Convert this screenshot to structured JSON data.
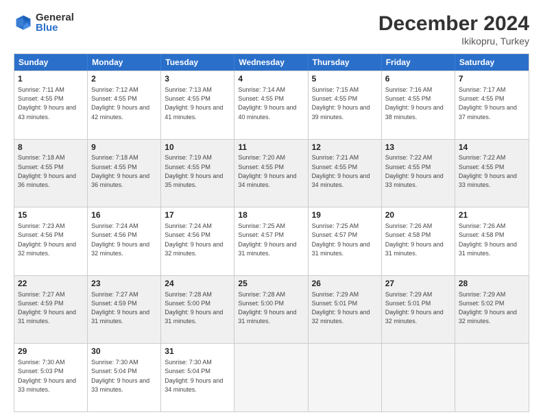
{
  "logo": {
    "general": "General",
    "blue": "Blue"
  },
  "title": "December 2024",
  "location": "Ikikopru, Turkey",
  "days": [
    "Sunday",
    "Monday",
    "Tuesday",
    "Wednesday",
    "Thursday",
    "Friday",
    "Saturday"
  ],
  "weeks": [
    [
      {
        "day": "1",
        "rise": "7:11 AM",
        "set": "4:55 PM",
        "daylight": "9 hours and 43 minutes."
      },
      {
        "day": "2",
        "rise": "7:12 AM",
        "set": "4:55 PM",
        "daylight": "9 hours and 42 minutes."
      },
      {
        "day": "3",
        "rise": "7:13 AM",
        "set": "4:55 PM",
        "daylight": "9 hours and 41 minutes."
      },
      {
        "day": "4",
        "rise": "7:14 AM",
        "set": "4:55 PM",
        "daylight": "9 hours and 40 minutes."
      },
      {
        "day": "5",
        "rise": "7:15 AM",
        "set": "4:55 PM",
        "daylight": "9 hours and 39 minutes."
      },
      {
        "day": "6",
        "rise": "7:16 AM",
        "set": "4:55 PM",
        "daylight": "9 hours and 38 minutes."
      },
      {
        "day": "7",
        "rise": "7:17 AM",
        "set": "4:55 PM",
        "daylight": "9 hours and 37 minutes."
      }
    ],
    [
      {
        "day": "8",
        "rise": "7:18 AM",
        "set": "4:55 PM",
        "daylight": "9 hours and 36 minutes."
      },
      {
        "day": "9",
        "rise": "7:18 AM",
        "set": "4:55 PM",
        "daylight": "9 hours and 36 minutes."
      },
      {
        "day": "10",
        "rise": "7:19 AM",
        "set": "4:55 PM",
        "daylight": "9 hours and 35 minutes."
      },
      {
        "day": "11",
        "rise": "7:20 AM",
        "set": "4:55 PM",
        "daylight": "9 hours and 34 minutes."
      },
      {
        "day": "12",
        "rise": "7:21 AM",
        "set": "4:55 PM",
        "daylight": "9 hours and 34 minutes."
      },
      {
        "day": "13",
        "rise": "7:22 AM",
        "set": "4:55 PM",
        "daylight": "9 hours and 33 minutes."
      },
      {
        "day": "14",
        "rise": "7:22 AM",
        "set": "4:55 PM",
        "daylight": "9 hours and 33 minutes."
      }
    ],
    [
      {
        "day": "15",
        "rise": "7:23 AM",
        "set": "4:56 PM",
        "daylight": "9 hours and 32 minutes."
      },
      {
        "day": "16",
        "rise": "7:24 AM",
        "set": "4:56 PM",
        "daylight": "9 hours and 32 minutes."
      },
      {
        "day": "17",
        "rise": "7:24 AM",
        "set": "4:56 PM",
        "daylight": "9 hours and 32 minutes."
      },
      {
        "day": "18",
        "rise": "7:25 AM",
        "set": "4:57 PM",
        "daylight": "9 hours and 31 minutes."
      },
      {
        "day": "19",
        "rise": "7:25 AM",
        "set": "4:57 PM",
        "daylight": "9 hours and 31 minutes."
      },
      {
        "day": "20",
        "rise": "7:26 AM",
        "set": "4:58 PM",
        "daylight": "9 hours and 31 minutes."
      },
      {
        "day": "21",
        "rise": "7:26 AM",
        "set": "4:58 PM",
        "daylight": "9 hours and 31 minutes."
      }
    ],
    [
      {
        "day": "22",
        "rise": "7:27 AM",
        "set": "4:59 PM",
        "daylight": "9 hours and 31 minutes."
      },
      {
        "day": "23",
        "rise": "7:27 AM",
        "set": "4:59 PM",
        "daylight": "9 hours and 31 minutes."
      },
      {
        "day": "24",
        "rise": "7:28 AM",
        "set": "5:00 PM",
        "daylight": "9 hours and 31 minutes."
      },
      {
        "day": "25",
        "rise": "7:28 AM",
        "set": "5:00 PM",
        "daylight": "9 hours and 31 minutes."
      },
      {
        "day": "26",
        "rise": "7:29 AM",
        "set": "5:01 PM",
        "daylight": "9 hours and 32 minutes."
      },
      {
        "day": "27",
        "rise": "7:29 AM",
        "set": "5:01 PM",
        "daylight": "9 hours and 32 minutes."
      },
      {
        "day": "28",
        "rise": "7:29 AM",
        "set": "5:02 PM",
        "daylight": "9 hours and 32 minutes."
      }
    ],
    [
      {
        "day": "29",
        "rise": "7:30 AM",
        "set": "5:03 PM",
        "daylight": "9 hours and 33 minutes."
      },
      {
        "day": "30",
        "rise": "7:30 AM",
        "set": "5:04 PM",
        "daylight": "9 hours and 33 minutes."
      },
      {
        "day": "31",
        "rise": "7:30 AM",
        "set": "5:04 PM",
        "daylight": "9 hours and 34 minutes."
      },
      null,
      null,
      null,
      null
    ]
  ]
}
